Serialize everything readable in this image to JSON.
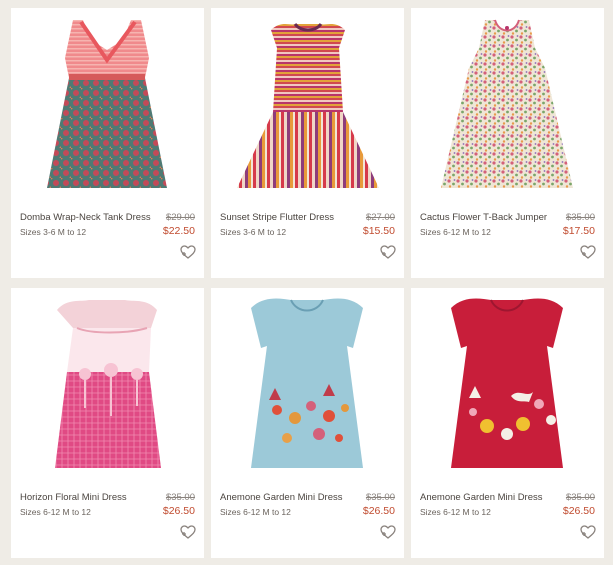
{
  "products": [
    {
      "name": "Domba Wrap-Neck Tank Dress",
      "sizes": "Sizes 3-6 M to 12",
      "original_price": "$29.00",
      "sale_price": "$22.50",
      "favorite_icon": "heart-plus-icon"
    },
    {
      "name": "Sunset Stripe Flutter Dress",
      "sizes": "Sizes 3-6 M to 12",
      "original_price": "$27.00",
      "sale_price": "$15.50",
      "favorite_icon": "heart-plus-icon"
    },
    {
      "name": "Cactus Flower T-Back Jumper",
      "sizes": "Sizes 6-12 M to 12",
      "original_price": "$35.00",
      "sale_price": "$17.50",
      "favorite_icon": "heart-plus-icon"
    },
    {
      "name": "Horizon Floral Mini Dress",
      "sizes": "Sizes 6-12 M to 12",
      "original_price": "$35.00",
      "sale_price": "$26.50",
      "favorite_icon": "heart-plus-icon"
    },
    {
      "name": "Anemone Garden Mini Dress",
      "sizes": "Sizes 6-12 M to 12",
      "original_price": "$35.00",
      "sale_price": "$26.50",
      "favorite_icon": "heart-plus-icon"
    },
    {
      "name": "Anemone Garden Mini Dress",
      "sizes": "Sizes 6-12 M to 12",
      "original_price": "$35.00",
      "sale_price": "$26.50",
      "favorite_icon": "heart-plus-icon"
    }
  ],
  "colors": {
    "background": "#efece6",
    "card": "#ffffff",
    "product_name": "#4b4540",
    "original_price": "#8a837e",
    "sale_price": "#c14b2f"
  }
}
